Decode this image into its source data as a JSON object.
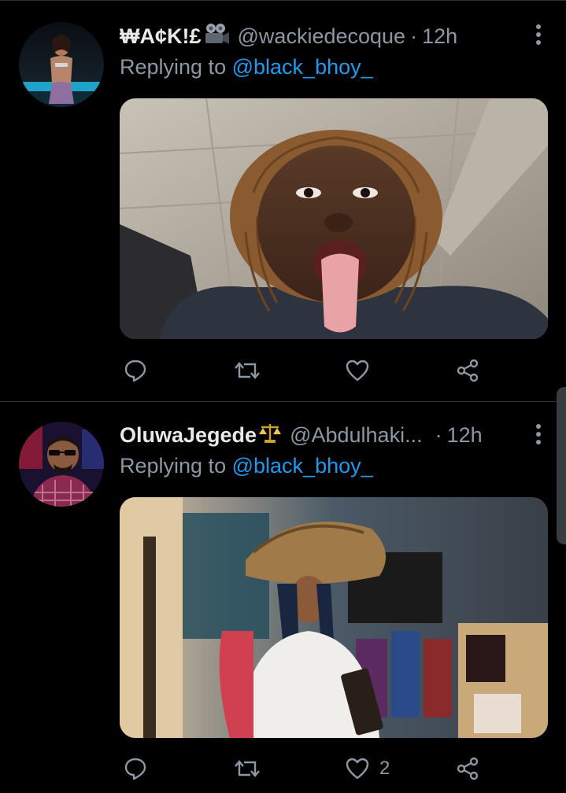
{
  "tweets": [
    {
      "display_name": "₩A¢K!£",
      "name_emoji": "video-camera-icon",
      "handle": "@wackiedecoque",
      "separator": "·",
      "time": "12h",
      "replying_prefix": "Replying to",
      "replying_to": "@black_bhoy_",
      "like_count": ""
    },
    {
      "display_name": "OluwaJegede",
      "name_emoji": "balance-scale-icon",
      "handle": "@Abdulhaki...",
      "separator": "·",
      "time": "12h",
      "replying_prefix": "Replying to",
      "replying_to": "@black_bhoy_",
      "like_count": "2"
    }
  ],
  "colors": {
    "background": "#000000",
    "text_primary": "#e7e9ea",
    "text_secondary": "#8b98a5",
    "link": "#1d9bf0",
    "divider": "#2f3336",
    "icon": "#8b98a5"
  }
}
